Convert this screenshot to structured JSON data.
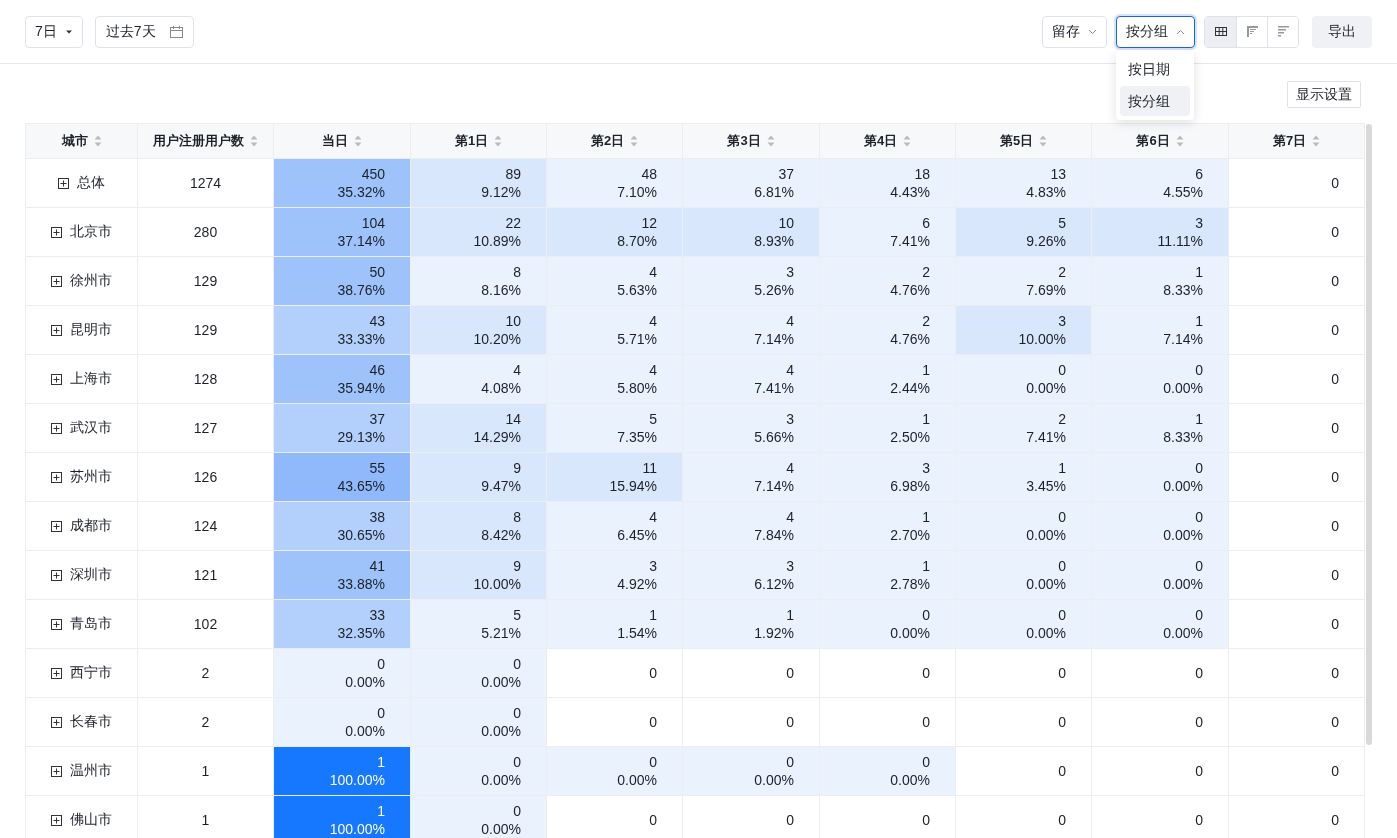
{
  "toolbar": {
    "period_select": "7日",
    "date_range": "过去7天",
    "metric_select": "留存",
    "group_select": "按分组",
    "group_menu": [
      {
        "label": "按日期",
        "selected": false
      },
      {
        "label": "按分组",
        "selected": true
      }
    ],
    "view_toggles": [
      {
        "kind": "table",
        "selected": true
      },
      {
        "kind": "chart",
        "selected": false
      },
      {
        "kind": "bars",
        "selected": false
      }
    ],
    "export_button": "导出"
  },
  "display_settings_button": "显示设置",
  "table": {
    "columns": [
      "城市",
      "用户注册用户数",
      "当日",
      "第1日",
      "第2日",
      "第3日",
      "第4日",
      "第5日",
      "第6日",
      "第7日"
    ],
    "rows": [
      {
        "name": "总体",
        "users": "1274",
        "cells": [
          {
            "value": "450",
            "percent": "35.32%",
            "color": "#9ec3fb"
          },
          {
            "value": "89",
            "percent": "9.12%",
            "color": "#d9e7fd"
          },
          {
            "value": "48",
            "percent": "7.10%",
            "color": "#eaf2fe"
          },
          {
            "value": "37",
            "percent": "6.81%",
            "color": "#eaf2fe"
          },
          {
            "value": "18",
            "percent": "4.43%",
            "color": "#eaf2fe"
          },
          {
            "value": "13",
            "percent": "4.83%",
            "color": "#eaf2fe"
          },
          {
            "value": "6",
            "percent": "4.55%",
            "color": "#eaf2fe"
          },
          {
            "value": "0"
          }
        ]
      },
      {
        "name": "北京市",
        "users": "280",
        "cells": [
          {
            "value": "104",
            "percent": "37.14%",
            "color": "#9ec3fb"
          },
          {
            "value": "22",
            "percent": "10.89%",
            "color": "#d9e7fd"
          },
          {
            "value": "12",
            "percent": "8.70%",
            "color": "#d9e7fd"
          },
          {
            "value": "10",
            "percent": "8.93%",
            "color": "#d9e7fd"
          },
          {
            "value": "6",
            "percent": "7.41%",
            "color": "#eaf2fe"
          },
          {
            "value": "5",
            "percent": "9.26%",
            "color": "#d9e7fd"
          },
          {
            "value": "3",
            "percent": "11.11%",
            "color": "#d9e7fd"
          },
          {
            "value": "0"
          }
        ]
      },
      {
        "name": "徐州市",
        "users": "129",
        "cells": [
          {
            "value": "50",
            "percent": "38.76%",
            "color": "#9ec3fb"
          },
          {
            "value": "8",
            "percent": "8.16%",
            "color": "#eaf2fe"
          },
          {
            "value": "4",
            "percent": "5.63%",
            "color": "#eaf2fe"
          },
          {
            "value": "3",
            "percent": "5.26%",
            "color": "#eaf2fe"
          },
          {
            "value": "2",
            "percent": "4.76%",
            "color": "#eaf2fe"
          },
          {
            "value": "2",
            "percent": "7.69%",
            "color": "#eaf2fe"
          },
          {
            "value": "1",
            "percent": "8.33%",
            "color": "#eaf2fe"
          },
          {
            "value": "0"
          }
        ]
      },
      {
        "name": "昆明市",
        "users": "129",
        "cells": [
          {
            "value": "43",
            "percent": "33.33%",
            "color": "#b3d0fc"
          },
          {
            "value": "10",
            "percent": "10.20%",
            "color": "#d9e7fd"
          },
          {
            "value": "4",
            "percent": "5.71%",
            "color": "#eaf2fe"
          },
          {
            "value": "4",
            "percent": "7.14%",
            "color": "#eaf2fe"
          },
          {
            "value": "2",
            "percent": "4.76%",
            "color": "#eaf2fe"
          },
          {
            "value": "3",
            "percent": "10.00%",
            "color": "#d9e7fd"
          },
          {
            "value": "1",
            "percent": "7.14%",
            "color": "#eaf2fe"
          },
          {
            "value": "0"
          }
        ]
      },
      {
        "name": "上海市",
        "users": "128",
        "cells": [
          {
            "value": "46",
            "percent": "35.94%",
            "color": "#9ec3fb"
          },
          {
            "value": "4",
            "percent": "4.08%",
            "color": "#eaf2fe"
          },
          {
            "value": "4",
            "percent": "5.80%",
            "color": "#eaf2fe"
          },
          {
            "value": "4",
            "percent": "7.41%",
            "color": "#eaf2fe"
          },
          {
            "value": "1",
            "percent": "2.44%",
            "color": "#eaf2fe"
          },
          {
            "value": "0",
            "percent": "0.00%",
            "color": "#eaf2fe"
          },
          {
            "value": "0",
            "percent": "0.00%",
            "color": "#eaf2fe"
          },
          {
            "value": "0"
          }
        ]
      },
      {
        "name": "武汉市",
        "users": "127",
        "cells": [
          {
            "value": "37",
            "percent": "29.13%",
            "color": "#b3d0fc"
          },
          {
            "value": "14",
            "percent": "14.29%",
            "color": "#d9e7fd"
          },
          {
            "value": "5",
            "percent": "7.35%",
            "color": "#eaf2fe"
          },
          {
            "value": "3",
            "percent": "5.66%",
            "color": "#eaf2fe"
          },
          {
            "value": "1",
            "percent": "2.50%",
            "color": "#eaf2fe"
          },
          {
            "value": "2",
            "percent": "7.41%",
            "color": "#eaf2fe"
          },
          {
            "value": "1",
            "percent": "8.33%",
            "color": "#eaf2fe"
          },
          {
            "value": "0"
          }
        ]
      },
      {
        "name": "苏州市",
        "users": "126",
        "cells": [
          {
            "value": "55",
            "percent": "43.65%",
            "color": "#8fb9fa"
          },
          {
            "value": "9",
            "percent": "9.47%",
            "color": "#d9e7fd"
          },
          {
            "value": "11",
            "percent": "15.94%",
            "color": "#d9e7fd"
          },
          {
            "value": "4",
            "percent": "7.14%",
            "color": "#eaf2fe"
          },
          {
            "value": "3",
            "percent": "6.98%",
            "color": "#eaf2fe"
          },
          {
            "value": "1",
            "percent": "3.45%",
            "color": "#eaf2fe"
          },
          {
            "value": "0",
            "percent": "0.00%",
            "color": "#eaf2fe"
          },
          {
            "value": "0"
          }
        ]
      },
      {
        "name": "成都市",
        "users": "124",
        "cells": [
          {
            "value": "38",
            "percent": "30.65%",
            "color": "#b3d0fc"
          },
          {
            "value": "8",
            "percent": "8.42%",
            "color": "#d9e7fd"
          },
          {
            "value": "4",
            "percent": "6.45%",
            "color": "#eaf2fe"
          },
          {
            "value": "4",
            "percent": "7.84%",
            "color": "#eaf2fe"
          },
          {
            "value": "1",
            "percent": "2.70%",
            "color": "#eaf2fe"
          },
          {
            "value": "0",
            "percent": "0.00%",
            "color": "#eaf2fe"
          },
          {
            "value": "0",
            "percent": "0.00%",
            "color": "#eaf2fe"
          },
          {
            "value": "0"
          }
        ]
      },
      {
        "name": "深圳市",
        "users": "121",
        "cells": [
          {
            "value": "41",
            "percent": "33.88%",
            "color": "#9ec3fb"
          },
          {
            "value": "9",
            "percent": "10.00%",
            "color": "#d9e7fd"
          },
          {
            "value": "3",
            "percent": "4.92%",
            "color": "#eaf2fe"
          },
          {
            "value": "3",
            "percent": "6.12%",
            "color": "#eaf2fe"
          },
          {
            "value": "1",
            "percent": "2.78%",
            "color": "#eaf2fe"
          },
          {
            "value": "0",
            "percent": "0.00%",
            "color": "#eaf2fe"
          },
          {
            "value": "0",
            "percent": "0.00%",
            "color": "#eaf2fe"
          },
          {
            "value": "0"
          }
        ]
      },
      {
        "name": "青岛市",
        "users": "102",
        "cells": [
          {
            "value": "33",
            "percent": "32.35%",
            "color": "#b3d0fc"
          },
          {
            "value": "5",
            "percent": "5.21%",
            "color": "#eaf2fe"
          },
          {
            "value": "1",
            "percent": "1.54%",
            "color": "#eaf2fe"
          },
          {
            "value": "1",
            "percent": "1.92%",
            "color": "#eaf2fe"
          },
          {
            "value": "0",
            "percent": "0.00%",
            "color": "#eaf2fe"
          },
          {
            "value": "0",
            "percent": "0.00%",
            "color": "#eaf2fe"
          },
          {
            "value": "0",
            "percent": "0.00%",
            "color": "#eaf2fe"
          },
          {
            "value": "0"
          }
        ]
      },
      {
        "name": "西宁市",
        "users": "2",
        "cells": [
          {
            "value": "0",
            "percent": "0.00%",
            "color": "#eaf2fe"
          },
          {
            "value": "0",
            "percent": "0.00%",
            "color": "#eaf2fe"
          },
          {
            "value": "0"
          },
          {
            "value": "0"
          },
          {
            "value": "0"
          },
          {
            "value": "0"
          },
          {
            "value": "0"
          },
          {
            "value": "0"
          }
        ]
      },
      {
        "name": "长春市",
        "users": "2",
        "cells": [
          {
            "value": "0",
            "percent": "0.00%",
            "color": "#eaf2fe"
          },
          {
            "value": "0",
            "percent": "0.00%",
            "color": "#eaf2fe"
          },
          {
            "value": "0"
          },
          {
            "value": "0"
          },
          {
            "value": "0"
          },
          {
            "value": "0"
          },
          {
            "value": "0"
          },
          {
            "value": "0"
          }
        ]
      },
      {
        "name": "温州市",
        "users": "1",
        "cells": [
          {
            "value": "1",
            "percent": "100.00%",
            "color": "#1677ff"
          },
          {
            "value": "0",
            "percent": "0.00%",
            "color": "#eaf2fe"
          },
          {
            "value": "0",
            "percent": "0.00%",
            "color": "#eaf2fe"
          },
          {
            "value": "0",
            "percent": "0.00%",
            "color": "#eaf2fe"
          },
          {
            "value": "0",
            "percent": "0.00%",
            "color": "#eaf2fe"
          },
          {
            "value": "0"
          },
          {
            "value": "0"
          },
          {
            "value": "0"
          }
        ]
      },
      {
        "name": "佛山市",
        "users": "1",
        "cells": [
          {
            "value": "1",
            "percent": "100.00%",
            "color": "#1677ff"
          },
          {
            "value": "0",
            "percent": "0.00%",
            "color": "#eaf2fe"
          },
          {
            "value": "0"
          },
          {
            "value": "0"
          },
          {
            "value": "0"
          },
          {
            "value": "0"
          },
          {
            "value": "0"
          },
          {
            "value": "0"
          }
        ]
      }
    ]
  }
}
